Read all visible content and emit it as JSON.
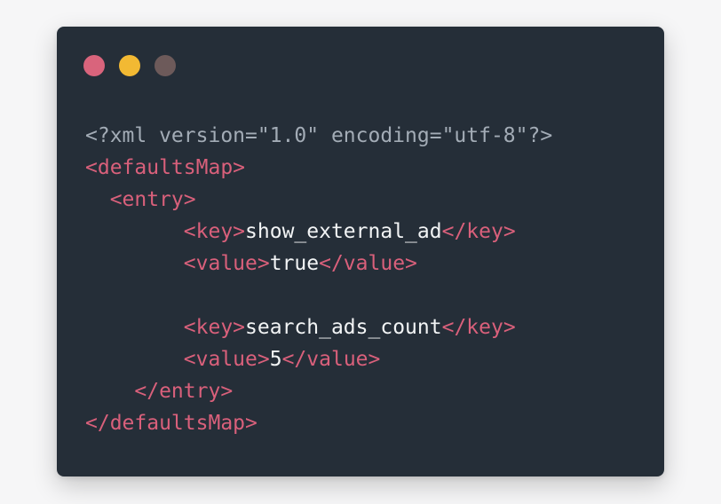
{
  "colors": {
    "background": "#f6f6f7",
    "window": "#252e38",
    "dot_red": "#d9647c",
    "dot_yellow": "#f2b933",
    "dot_gray": "#6d5a5a",
    "declaration": "#a3acb6",
    "tag": "#d9607b",
    "text": "#f2f4f5"
  },
  "window_controls": [
    {
      "name": "close-dot"
    },
    {
      "name": "minimize-dot"
    },
    {
      "name": "maximize-dot"
    }
  ],
  "code": {
    "declaration": "<?xml version=\"1.0\" encoding=\"utf-8\"?>",
    "defaults_open": "<defaultsMap>",
    "entry_open": "  <entry>",
    "key1_indent": "        ",
    "key1_open": "<key>",
    "key1_text": "show_external_ad",
    "key1_close": "</key>",
    "value1_indent": "        ",
    "value1_open": "<value>",
    "value1_text": "true",
    "value1_close": "</value>",
    "key2_indent": "        ",
    "key2_open": "<key>",
    "key2_text": "search_ads_count",
    "key2_close": "</key>",
    "value2_indent": "        ",
    "value2_open": "<value>",
    "value2_text": "5",
    "value2_close": "</value>",
    "entry_close": "    </entry>",
    "defaults_close": "</defaultsMap>"
  }
}
